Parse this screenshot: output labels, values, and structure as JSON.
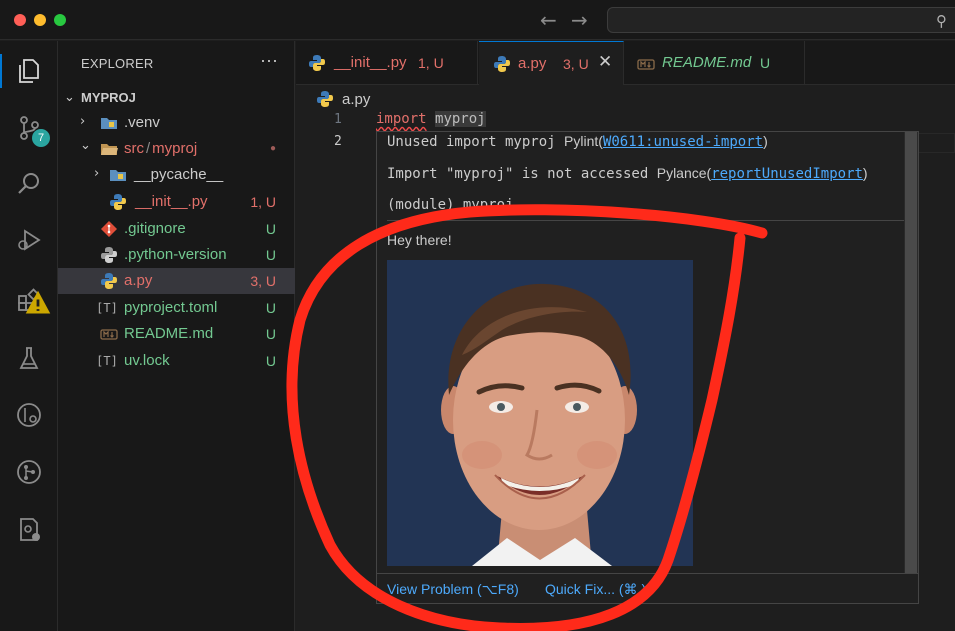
{
  "titlebar": {
    "back": "←",
    "forward": "→"
  },
  "explorer": {
    "title": "EXPLORER",
    "more": "···",
    "root": "MYPROJ",
    "items": [
      {
        "name": ".venv",
        "status": ""
      },
      {
        "name_a": "src",
        "name_sep": "/",
        "name_b": "myproj",
        "status": "●"
      },
      {
        "name": "__pycache__",
        "status": ""
      },
      {
        "name": "__init__.py",
        "status": "1, U"
      },
      {
        "name": ".gitignore",
        "status": "U"
      },
      {
        "name": ".python-version",
        "status": "U"
      },
      {
        "name": "a.py",
        "status": "3, U"
      },
      {
        "name": "pyproject.toml",
        "status": "U"
      },
      {
        "name": "README.md",
        "status": "U"
      },
      {
        "name": "uv.lock",
        "status": "U"
      }
    ]
  },
  "activity": {
    "scm_badge": "7"
  },
  "tabs": [
    {
      "label": "__init__.py",
      "status": "1, U"
    },
    {
      "label": "a.py",
      "status": "3, U",
      "close": "✕"
    },
    {
      "label": "README.md",
      "status": "U"
    }
  ],
  "breadcrumb": "a.py",
  "editor": {
    "lines": [
      "1",
      "2"
    ],
    "keyword": "import",
    "module": "myproj"
  },
  "hover": {
    "line1_code": "Unused import myproj",
    "line1_src": "Pylint(",
    "line1_link": "W0611:unused-import",
    "line1_end": ")",
    "line2_code": "Import \"myproj\" is not accessed",
    "line2_src": "Pylance(",
    "line2_link": "reportUnusedImport",
    "line2_end": ")",
    "line3_code": "(module) myproj",
    "message": "Hey there!",
    "action_view": "View Problem (⌥F8)",
    "action_fix": "Quick Fix... (⌘.)"
  },
  "colors": {
    "accent": "#0078d4",
    "annotation": "#ff2a1a",
    "untracked": "#73c991",
    "error": "#f14c4c"
  }
}
